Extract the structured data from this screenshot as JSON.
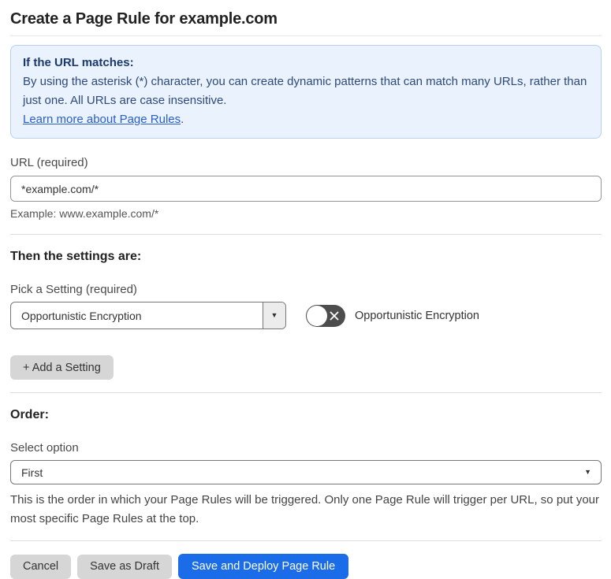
{
  "page": {
    "title": "Create a Page Rule for example.com"
  },
  "info_box": {
    "heading": "If the URL matches:",
    "body": "By using the asterisk (*) character, you can create dynamic patterns that can match many URLs, rather than just one. All URLs are case insensitive.",
    "link": "Learn more about Page Rules",
    "link_suffix": "."
  },
  "url_field": {
    "label": "URL (required)",
    "value": "*example.com/*",
    "helper": "Example: www.example.com/*"
  },
  "settings": {
    "heading": "Then the settings are:",
    "picker_label": "Pick a Setting (required)",
    "picker_value": "Opportunistic Encryption",
    "toggle_label": "Opportunistic Encryption",
    "toggle_state": "off",
    "add_button_label": "+ Add a Setting"
  },
  "order": {
    "heading": "Order:",
    "select_label": "Select option",
    "select_value": "First",
    "helper": "This is the order in which your Page Rules will be triggered. Only one Page Rule will trigger per URL, so put your most specific Page Rules at the top."
  },
  "footer": {
    "cancel_label": "Cancel",
    "save_draft_label": "Save as Draft",
    "save_deploy_label": "Save and Deploy Page Rule"
  },
  "colors": {
    "accent_blue": "#1a6ce8",
    "info_box_bg": "#e9f2fd",
    "info_box_border": "#b8cff2",
    "info_heading_text": "#1b3a6b",
    "info_body_text": "#2e4a78",
    "link_blue": "#2b5fc7",
    "toggle_off_bg": "#4d4d4d",
    "grey_button_bg": "#d6d6d6"
  }
}
